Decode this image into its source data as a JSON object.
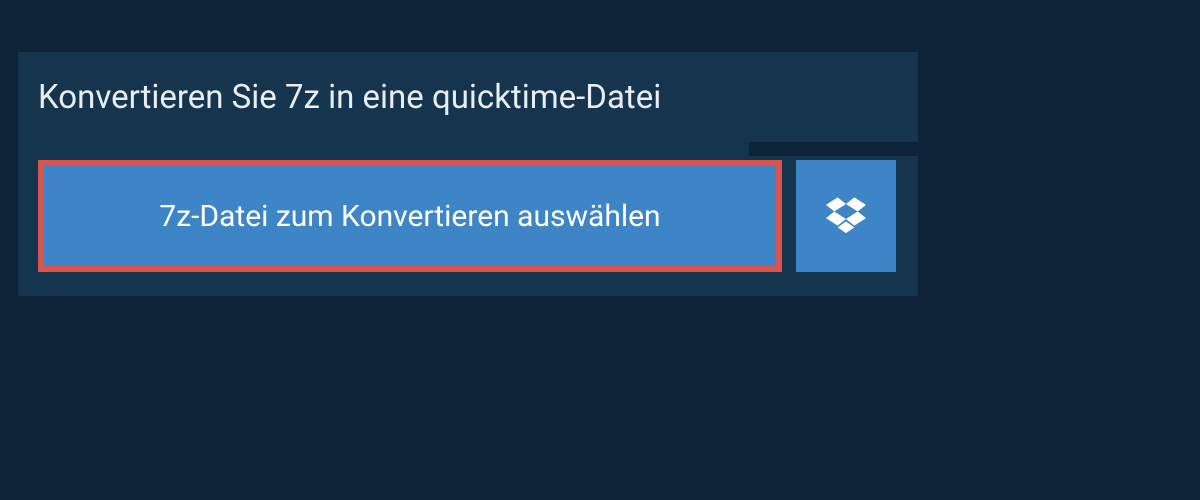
{
  "heading": "Konvertieren Sie 7z in eine quicktime-Datei",
  "select_button_label": "7z-Datei zum Konvertieren auswählen",
  "colors": {
    "page_bg": "#0d2438",
    "panel_bg": "#15354f",
    "button_bg": "#3d85c6",
    "highlight_border": "#d9544f"
  }
}
